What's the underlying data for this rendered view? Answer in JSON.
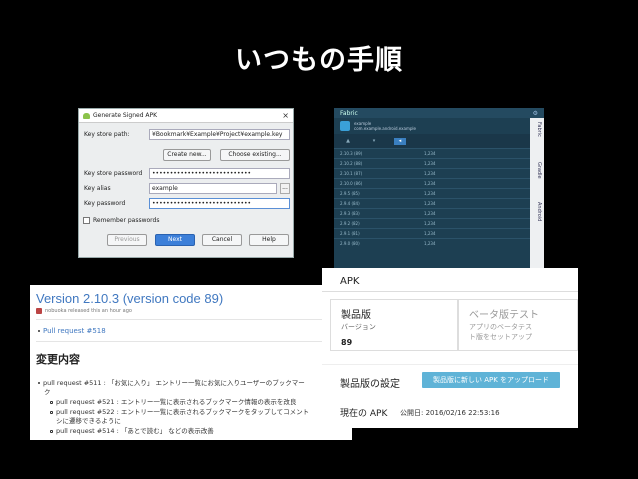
{
  "slide": {
    "title": "いつもの手順"
  },
  "signing_dialog": {
    "title": "Generate Signed APK",
    "key_store_path_label": "Key store path:",
    "key_store_path_value": "¥Bookmark¥Example¥Project¥example.key",
    "create_new_label": "Create new...",
    "choose_existing_label": "Choose existing...",
    "key_store_password_label": "Key store password",
    "key_store_password_value": "••••••••••••••••••••••••••••",
    "key_alias_label": "Key alias",
    "key_alias_value": "example",
    "key_alias_button": "...",
    "key_password_label": "Key password",
    "key_password_value": "••••••••••••••••••••••••••••",
    "remember_label": "Remember passwords",
    "buttons": {
      "previous": "Previous",
      "next": "Next",
      "cancel": "Cancel",
      "help": "Help"
    }
  },
  "fabric": {
    "title": "Fabric",
    "app_name": "example",
    "app_id": "com.example.android.example",
    "rows": [
      {
        "c1": "2.10.3 (89)",
        "c2": "1,234",
        "c3": "›"
      },
      {
        "c1": "2.10.2 (88)",
        "c2": "1,234",
        "c3": "›"
      },
      {
        "c1": "2.10.1 (87)",
        "c2": "1,234",
        "c3": "›"
      },
      {
        "c1": "2.10.0 (86)",
        "c2": "1,234",
        "c3": "›"
      },
      {
        "c1": "2.9.5 (85)",
        "c2": "1,234",
        "c3": "›"
      },
      {
        "c1": "2.9.4 (84)",
        "c2": "1,234",
        "c3": "›"
      },
      {
        "c1": "2.9.3 (83)",
        "c2": "1,234",
        "c3": "›"
      },
      {
        "c1": "2.9.2 (82)",
        "c2": "1,234",
        "c3": "›"
      },
      {
        "c1": "2.9.1 (81)",
        "c2": "1,234",
        "c3": "›"
      },
      {
        "c1": "2.9.0 (80)",
        "c2": "1,234",
        "c3": "›"
      }
    ],
    "side_labels": [
      "Fabric",
      "Gradle",
      "Android"
    ]
  },
  "release": {
    "version": "Version 2.10.3 (version code 89)",
    "meta": "nobuoka released this an hour ago",
    "pr_top": "Pull request #518",
    "heading": "変更内容",
    "items": [
      "pull request #511 : 「お気に入り」 エントリー一覧にお気に入りユーザーのブックマー",
      "ク",
      "pull request #521 : エントリー一覧に表示されるブックマーク情報の表示を改良",
      "pull request #522 : エントリー一覧に表示されるブックマークをタップしてコメント",
      "シに遷移できるように",
      "pull request #514 : 「あとで読む」 などの表示改善"
    ]
  },
  "play_console": {
    "header": "APK",
    "production": {
      "title": "製品版",
      "subtitle": "バージョン",
      "version": "89"
    },
    "beta": {
      "title": "ベータ版テスト",
      "desc_line1": "アプリのベータテス",
      "desc_line2": "ト版をセットアップ"
    },
    "settings_label": "製品版の設定",
    "upload_button": "製品版に新しい APK をアップロード",
    "current_label": "現在の APK",
    "published_date": "公開日: 2016/02/16 22:53:16"
  }
}
